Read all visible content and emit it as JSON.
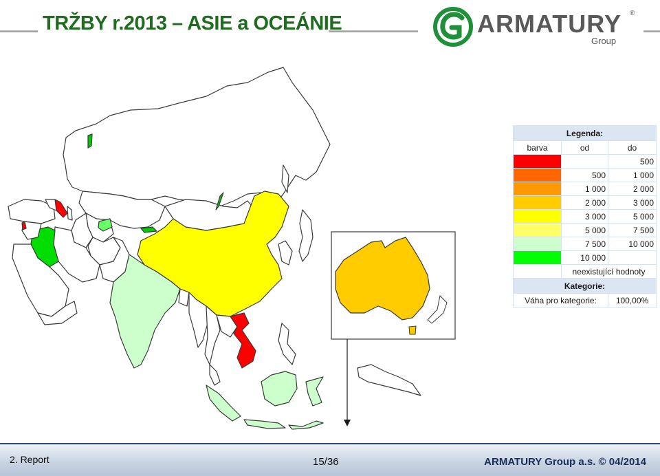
{
  "header": {
    "title": "TRŽBY r.2013 – ASIE a OCEÁNIE",
    "logo": {
      "name": "ARMATURY",
      "registered": "®",
      "subtitle": "Group",
      "color": "#1f8f3a"
    }
  },
  "map": {
    "region_colors": {
      "russia": "#ffffff",
      "china": "#ffff00",
      "india": "#ccffcc",
      "indonesia": "#ccffcc",
      "vietnam": "#ff0000",
      "azerbaijan": "#ff0000",
      "iraq": "#00dd00",
      "kyrgyzstan": "#66ff66",
      "australia": "#ffcc00"
    }
  },
  "legend": {
    "title": "Legenda:",
    "columns": {
      "color": "barva",
      "from": "od",
      "to": "do"
    },
    "rows": [
      {
        "color": "#ff0000",
        "from": "",
        "to": "500"
      },
      {
        "color": "#ff6600",
        "from": "500",
        "to": "1 000"
      },
      {
        "color": "#ff9900",
        "from": "1 000",
        "to": "2 000"
      },
      {
        "color": "#ffcc00",
        "from": "2 000",
        "to": "3 000"
      },
      {
        "color": "#ffff00",
        "from": "3 000",
        "to": "5 000"
      },
      {
        "color": "#ffff66",
        "from": "5 000",
        "to": "7 500"
      },
      {
        "color": "#ccffcc",
        "from": "7 500",
        "to": "10 000"
      },
      {
        "color": "#00ff00",
        "from": "10 000",
        "to": ""
      }
    ],
    "nonexistent": "neexistující hodnoty",
    "category_title": "Kategorie:",
    "weight_label": "Váha pro kategorie:",
    "weight_value": "100,00%"
  },
  "footer": {
    "report": "2. Report",
    "page": "15/36",
    "company": "ARMATURY Group a.s. © 04/2014"
  }
}
